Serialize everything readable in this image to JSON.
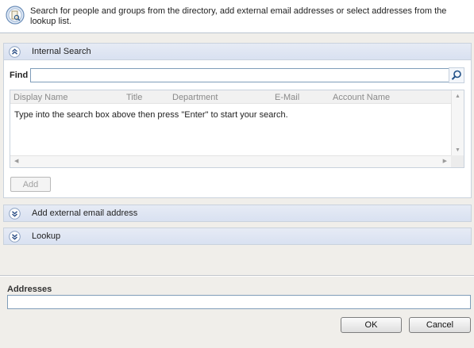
{
  "header": {
    "description": "Search for people and groups from the directory, add external email addresses or select addresses from the lookup list.",
    "icon": "address-book-search-icon"
  },
  "sections": {
    "internal_search": {
      "label": "Internal Search",
      "state": "expanded"
    },
    "external_email": {
      "label": "Add external email address",
      "state": "collapsed"
    },
    "lookup": {
      "label": "Lookup",
      "state": "collapsed"
    }
  },
  "find": {
    "label": "Find",
    "value": "",
    "placeholder": ""
  },
  "results": {
    "columns": [
      "Display Name",
      "Title",
      "Department",
      "E-Mail",
      "Account Name"
    ],
    "message": "Type into the search box above then press \"Enter\" to start your search."
  },
  "add_button": {
    "label": "Add"
  },
  "addresses": {
    "label": "Addresses",
    "value": ""
  },
  "buttons": {
    "ok": "OK",
    "cancel": "Cancel"
  },
  "colors": {
    "section_header_bg": "#dde4f3",
    "panel_border": "#c9d2dd",
    "input_border": "#7f9db9",
    "dialog_bg": "#f0eeea"
  }
}
